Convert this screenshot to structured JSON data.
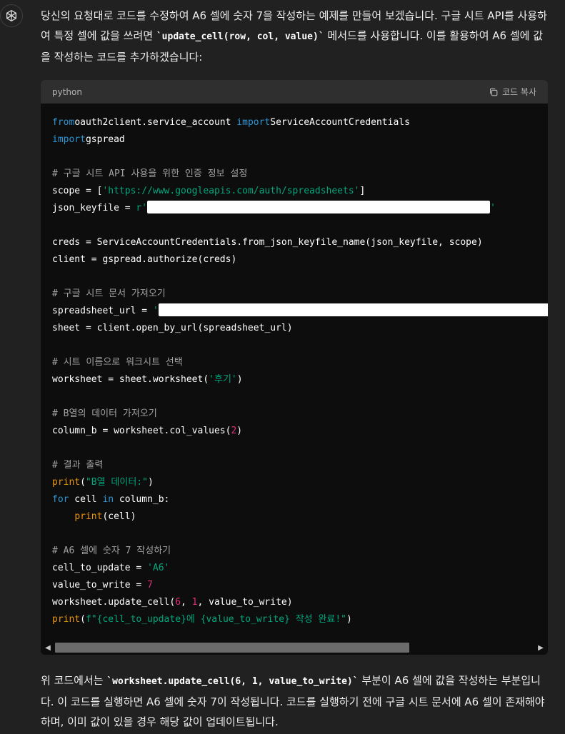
{
  "intro": {
    "line1": "당신의 요청대로 코드를 수정하여 A6 셀에 숫자 7을 작성하는 예제를 만들어 보겠습니다. 구글 시트 API를 사용하여 특정 셀에 값을 쓰려면 ",
    "code": "`update_cell(row, col, value)`",
    "line2": " 메서드를 사용합니다. 이를 활용하여 A6 셀에 값을 작성하는 코드를 추가하겠습니다:"
  },
  "code_block": {
    "language": "python",
    "copy_label": "코드 복사",
    "lines": [
      {
        "t": [
          [
            "kw",
            "from"
          ],
          [
            "",
            "oauth2client.service_account "
          ],
          [
            "kw",
            "import"
          ],
          [
            "",
            "ServiceAccountCredentials"
          ]
        ]
      },
      {
        "t": [
          [
            "kw",
            "import"
          ],
          [
            "",
            "gspread"
          ]
        ]
      },
      {
        "t": []
      },
      {
        "t": [
          [
            "cmt",
            "# 구글 시트 API 사용을 위한 인증 정보 설정"
          ]
        ]
      },
      {
        "t": [
          [
            "",
            "scope = ["
          ],
          [
            "str",
            "'https://www.googleapis.com/auth/spreadsheets'"
          ],
          [
            "",
            "]"
          ]
        ]
      },
      {
        "t": [
          [
            "",
            "json_keyfile = "
          ],
          [
            "str",
            "r'"
          ],
          [
            "redact",
            "480"
          ],
          [
            "str",
            "'"
          ]
        ]
      },
      {
        "t": []
      },
      {
        "t": [
          [
            "",
            "creds = ServiceAccountCredentials.from_json_keyfile_name(json_keyfile, scope)"
          ]
        ]
      },
      {
        "t": [
          [
            "",
            "client = gspread.authorize(creds)"
          ]
        ]
      },
      {
        "t": []
      },
      {
        "t": [
          [
            "cmt",
            "# 구글 시트 문서 가져오기"
          ]
        ]
      },
      {
        "t": [
          [
            "",
            "spreadsheet_url = "
          ],
          [
            "str",
            "'"
          ],
          [
            "redact",
            "560"
          ]
        ]
      },
      {
        "t": [
          [
            "",
            "sheet = client.open_by_url(spreadsheet_url)"
          ]
        ]
      },
      {
        "t": []
      },
      {
        "t": [
          [
            "cmt",
            "# 시트 이름으로 워크시트 선택"
          ]
        ]
      },
      {
        "t": [
          [
            "",
            "worksheet = sheet.worksheet("
          ],
          [
            "str",
            "'후기'"
          ],
          [
            "",
            ")"
          ]
        ]
      },
      {
        "t": []
      },
      {
        "t": [
          [
            "cmt",
            "# B열의 데이터 가져오기"
          ]
        ]
      },
      {
        "t": [
          [
            "",
            "column_b = worksheet.col_values("
          ],
          [
            "num",
            "2"
          ],
          [
            "",
            ")"
          ]
        ]
      },
      {
        "t": []
      },
      {
        "t": [
          [
            "cmt",
            "# 결과 출력"
          ]
        ]
      },
      {
        "t": [
          [
            "fn",
            "print"
          ],
          [
            "",
            "("
          ],
          [
            "str",
            "\"B열 데이터:\""
          ],
          [
            "",
            ")"
          ]
        ]
      },
      {
        "t": [
          [
            "kw",
            "for"
          ],
          [
            "",
            " cell "
          ],
          [
            "kw",
            "in"
          ],
          [
            "",
            " column_b:"
          ]
        ]
      },
      {
        "t": [
          [
            "",
            "    "
          ],
          [
            "fn",
            "print"
          ],
          [
            "",
            "(cell)"
          ]
        ]
      },
      {
        "t": []
      },
      {
        "t": [
          [
            "cmt",
            "# A6 셀에 숫자 7 작성하기"
          ]
        ]
      },
      {
        "t": [
          [
            "",
            "cell_to_update = "
          ],
          [
            "str",
            "'A6'"
          ]
        ]
      },
      {
        "t": [
          [
            "",
            "value_to_write = "
          ],
          [
            "num",
            "7"
          ]
        ]
      },
      {
        "t": [
          [
            "",
            "worksheet.update_cell("
          ],
          [
            "num",
            "6"
          ],
          [
            "",
            ", "
          ],
          [
            "num",
            "1"
          ],
          [
            "",
            ", value_to_write)"
          ]
        ]
      },
      {
        "t": [
          [
            "fn",
            "print"
          ],
          [
            "",
            "("
          ],
          [
            "str",
            "f\"{cell_to_update}에 {value_to_write} 작성 완료!\""
          ],
          [
            "",
            ")"
          ]
        ]
      }
    ]
  },
  "outro": {
    "line1": "위 코드에서는 ",
    "code": "`worksheet.update_cell(6, 1, value_to_write)`",
    "line2": " 부분이 A6 셀에 값을 작성하는 부분입니다. 이 코드를 실행하면 A6 셀에 숫자 7이 작성됩니다. 코드를 실행하기 전에 구글 시트 문서에 A6 셀이 존재해야 하며, 이미 값이 있을 경우 해당 값이 업데이트됩니다."
  },
  "colors": {
    "background": "#212121",
    "code_bg": "#0d0d0d",
    "keyword": "#2e95d3",
    "string": "#00a67d",
    "number": "#df3079",
    "comment": "#a0a0a0",
    "builtin": "#e9950c"
  },
  "scrollbar": {
    "position_fraction": 0.0,
    "visible_fraction": 0.74
  }
}
